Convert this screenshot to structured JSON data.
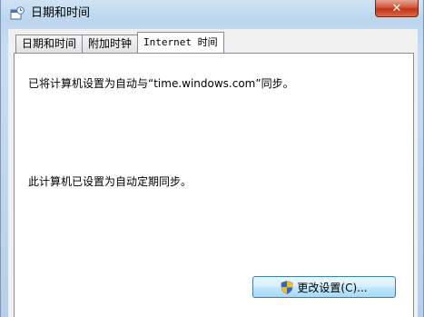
{
  "window": {
    "title": "日期和时间",
    "close_label": "✕"
  },
  "tabs": [
    {
      "label": "日期和时间"
    },
    {
      "label": "附加时钟"
    },
    {
      "label": "Internet 时间"
    }
  ],
  "panel": {
    "status_line1": "已将计算机设置为自动与“time.windows.com”同步。",
    "status_line2": "此计算机已设置为自动定期同步。",
    "change_button_label": "更改设置(C)..."
  }
}
